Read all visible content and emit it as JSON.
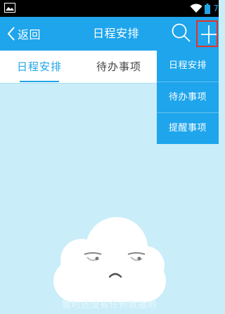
{
  "status_bar": {
    "time": "7"
  },
  "app_bar": {
    "back_label": "返回",
    "title": "日程安排"
  },
  "tabs": [
    {
      "label": "日程安排",
      "active": true
    },
    {
      "label": "待办事项",
      "active": false
    }
  ],
  "dropdown_menu": {
    "items": [
      {
        "label": "日程安排"
      },
      {
        "label": "待办事项"
      },
      {
        "label": "提醒事项"
      }
    ]
  },
  "empty_state": {
    "message": "暂时还没有任何数据哟"
  },
  "icons": {
    "status_left": "image-icon",
    "wifi": "wifi-icon",
    "battery": "battery-icon",
    "back": "chevron-left-icon",
    "search": "search-icon",
    "add": "plus-icon",
    "empty": "sad-cloud-icon"
  },
  "colors": {
    "primary": "#1ea5ec",
    "background": "#c9edf9",
    "highlight_border": "#e1332d"
  }
}
